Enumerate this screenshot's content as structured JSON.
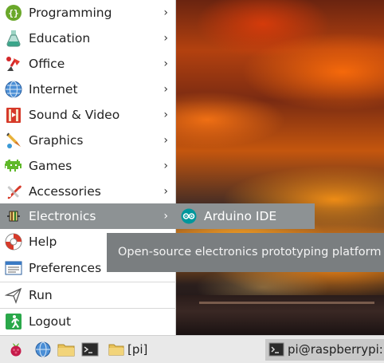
{
  "menu": {
    "items": [
      {
        "label": "Programming",
        "icon": "programming-icon",
        "submenu": true
      },
      {
        "label": "Education",
        "icon": "education-icon",
        "submenu": true
      },
      {
        "label": "Office",
        "icon": "office-icon",
        "submenu": true
      },
      {
        "label": "Internet",
        "icon": "internet-icon",
        "submenu": true
      },
      {
        "label": "Sound & Video",
        "icon": "sound-video-icon",
        "submenu": true
      },
      {
        "label": "Graphics",
        "icon": "graphics-icon",
        "submenu": true
      },
      {
        "label": "Games",
        "icon": "games-icon",
        "submenu": true
      },
      {
        "label": "Accessories",
        "icon": "accessories-icon",
        "submenu": true
      },
      {
        "label": "Electronics",
        "icon": "electronics-icon",
        "submenu": true
      },
      {
        "label": "Help",
        "icon": "help-icon",
        "submenu": true
      },
      {
        "label": "Preferences",
        "icon": "preferences-icon",
        "submenu": true
      },
      {
        "label": "Run",
        "icon": "run-icon",
        "submenu": false
      },
      {
        "label": "Logout",
        "icon": "logout-icon",
        "submenu": false
      }
    ],
    "active": "Electronics",
    "chevron": "›"
  },
  "submenu": {
    "label": "Arduino IDE",
    "icon": "arduino-icon"
  },
  "tooltip": {
    "text": "Open-source electronics prototyping platform"
  },
  "taskbar": {
    "launchers": [
      "raspberry-menu-icon",
      "web-browser-icon",
      "file-manager-icon",
      "terminal-icon"
    ],
    "tasks": [
      {
        "label": "[pi]",
        "icon": "folder-icon"
      },
      {
        "label": "pi@raspberrypi: ~",
        "icon": "terminal-icon"
      }
    ]
  },
  "colors": {
    "highlight": "#8d9294",
    "tooltip_bg": "#7a7e80",
    "menu_bg": "#ffffff",
    "taskbar_bg": "#e9e9e9"
  }
}
